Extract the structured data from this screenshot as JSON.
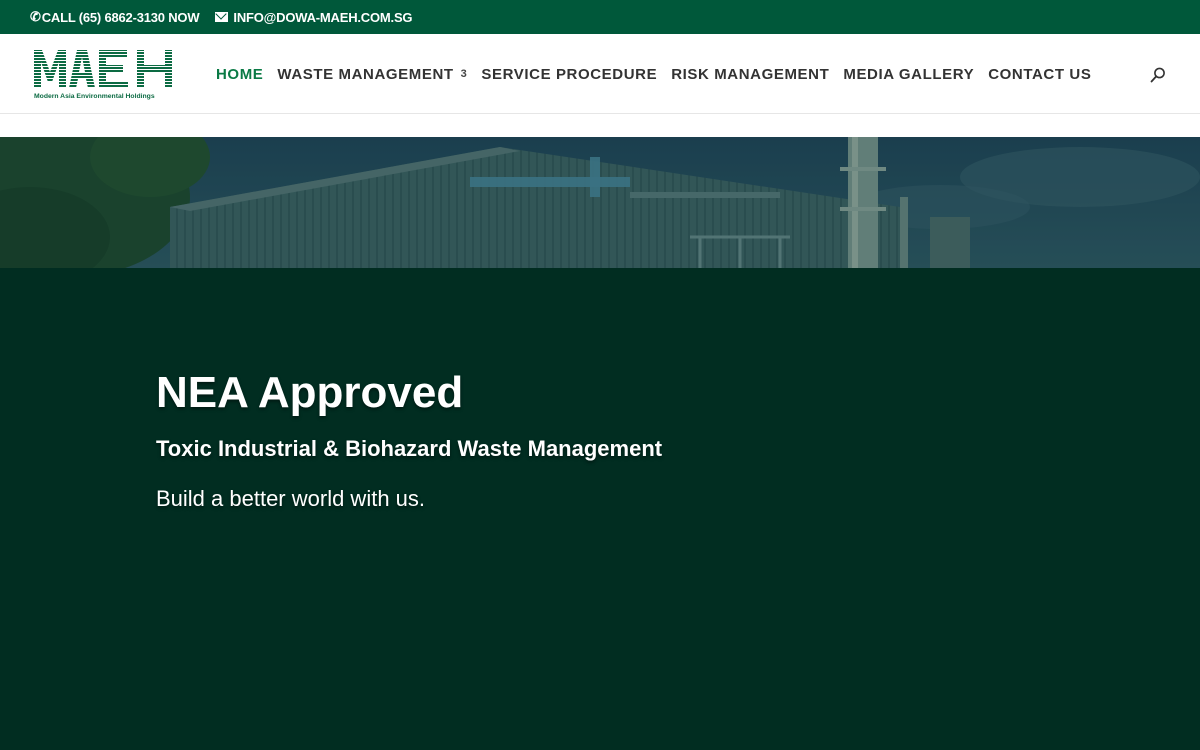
{
  "topbar": {
    "phone_icon": "phone-icon",
    "phone_text": "CALL (65) 6862-3130 NOW",
    "email_icon": "envelope-icon",
    "email_text": "INFO@DOWA-MAEH.COM.SG"
  },
  "logo": {
    "wordmark": "MAEH",
    "tagline": "Modern Asia Environmental Holdings"
  },
  "nav": {
    "items": [
      {
        "label": "HOME",
        "active": true
      },
      {
        "label": "WASTE MANAGEMENT",
        "has_dropdown": true,
        "dropdown_glyph": "3"
      },
      {
        "label": "SERVICE PROCEDURE"
      },
      {
        "label": "RISK MANAGEMENT"
      },
      {
        "label": "MEDIA GALLERY"
      },
      {
        "label": "CONTACT US"
      }
    ],
    "search_icon": "search-icon"
  },
  "hero": {
    "title": "NEA Approved",
    "subtitle": "Toxic Industrial & Biohazard Waste Management",
    "tagline": "Build a better world with us."
  },
  "colors": {
    "topbar_bg": "#00583a",
    "nav_active": "#0a7a45",
    "nav_text": "#333333",
    "hero_bg": "#012d21",
    "logo_green": "#0c6b43"
  }
}
